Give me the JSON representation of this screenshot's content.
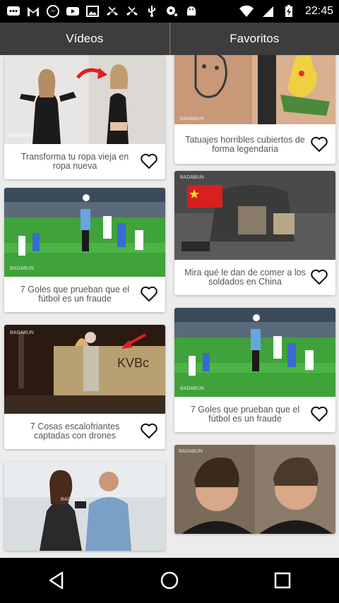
{
  "status_bar": {
    "time": "22:45",
    "icons": [
      "chat-icon",
      "gmail-icon",
      "messenger-icon",
      "youtube-icon",
      "image-icon",
      "missed-call-icon",
      "missed-call-icon",
      "usb-icon",
      "find-icon",
      "android-icon",
      "wifi-icon",
      "signal-icon",
      "battery-charging-icon"
    ]
  },
  "tabs": [
    {
      "label": "Vídeos"
    },
    {
      "label": "Favoritos"
    }
  ],
  "videos": [
    {
      "caption": "Transforma tu ropa vieja en ropa nueva",
      "watermark": "BADABUN"
    },
    {
      "caption": "7 Goles que prueban que el fútbol es un fraude",
      "watermark": "BADABUN"
    },
    {
      "caption": "7 Cosas escalofriantes captadas con drones",
      "watermark": "BADABUN"
    },
    {
      "caption": "",
      "watermark": "BADABUN"
    }
  ],
  "favorites": [
    {
      "caption": "Tatuajes horribles cubiertos de forma legendaria",
      "watermark": "BADABUN"
    },
    {
      "caption": "Mira qué le dan de comer a los soldados en China",
      "watermark": "BADABUN"
    },
    {
      "caption": "7 Goles que prueban que el fútbol es un fraude",
      "watermark": "BADABUN"
    },
    {
      "caption": "",
      "watermark": "BADABUN"
    }
  ],
  "nav": [
    "back-icon",
    "home-icon",
    "recents-icon"
  ]
}
